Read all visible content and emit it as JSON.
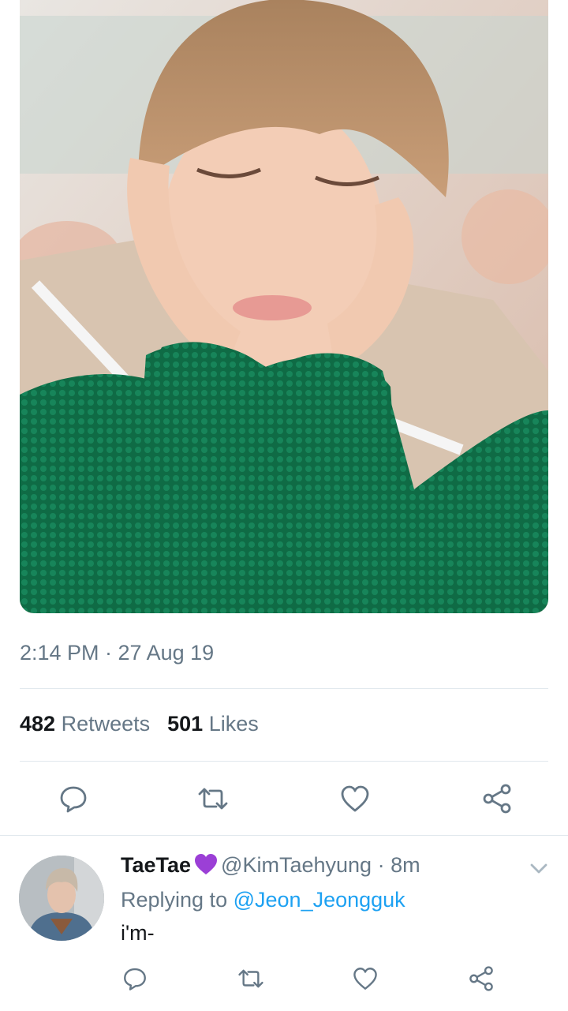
{
  "tweet": {
    "media_alt": "photo",
    "timestamp": "2:14 PM · 27 Aug 19",
    "stats": {
      "retweets_count": "482",
      "retweets_label": "Retweets",
      "likes_count": "501",
      "likes_label": "Likes"
    },
    "actions": [
      "reply-icon",
      "retweet-icon",
      "like-icon",
      "share-icon"
    ]
  },
  "reply": {
    "display_name": "TaeTae",
    "emoji": "purple-heart",
    "handle": "@KimTaehyung",
    "separator": "·",
    "time": "8m",
    "replying_prefix": "Replying to",
    "replying_to": "@Jeon_Jeongguk",
    "text": "i'm-"
  },
  "colors": {
    "text_primary": "#14171a",
    "text_secondary": "#657786",
    "link": "#1da1f2",
    "divider": "#e1e8ed",
    "emoji_purple": "#9b3fd6"
  }
}
